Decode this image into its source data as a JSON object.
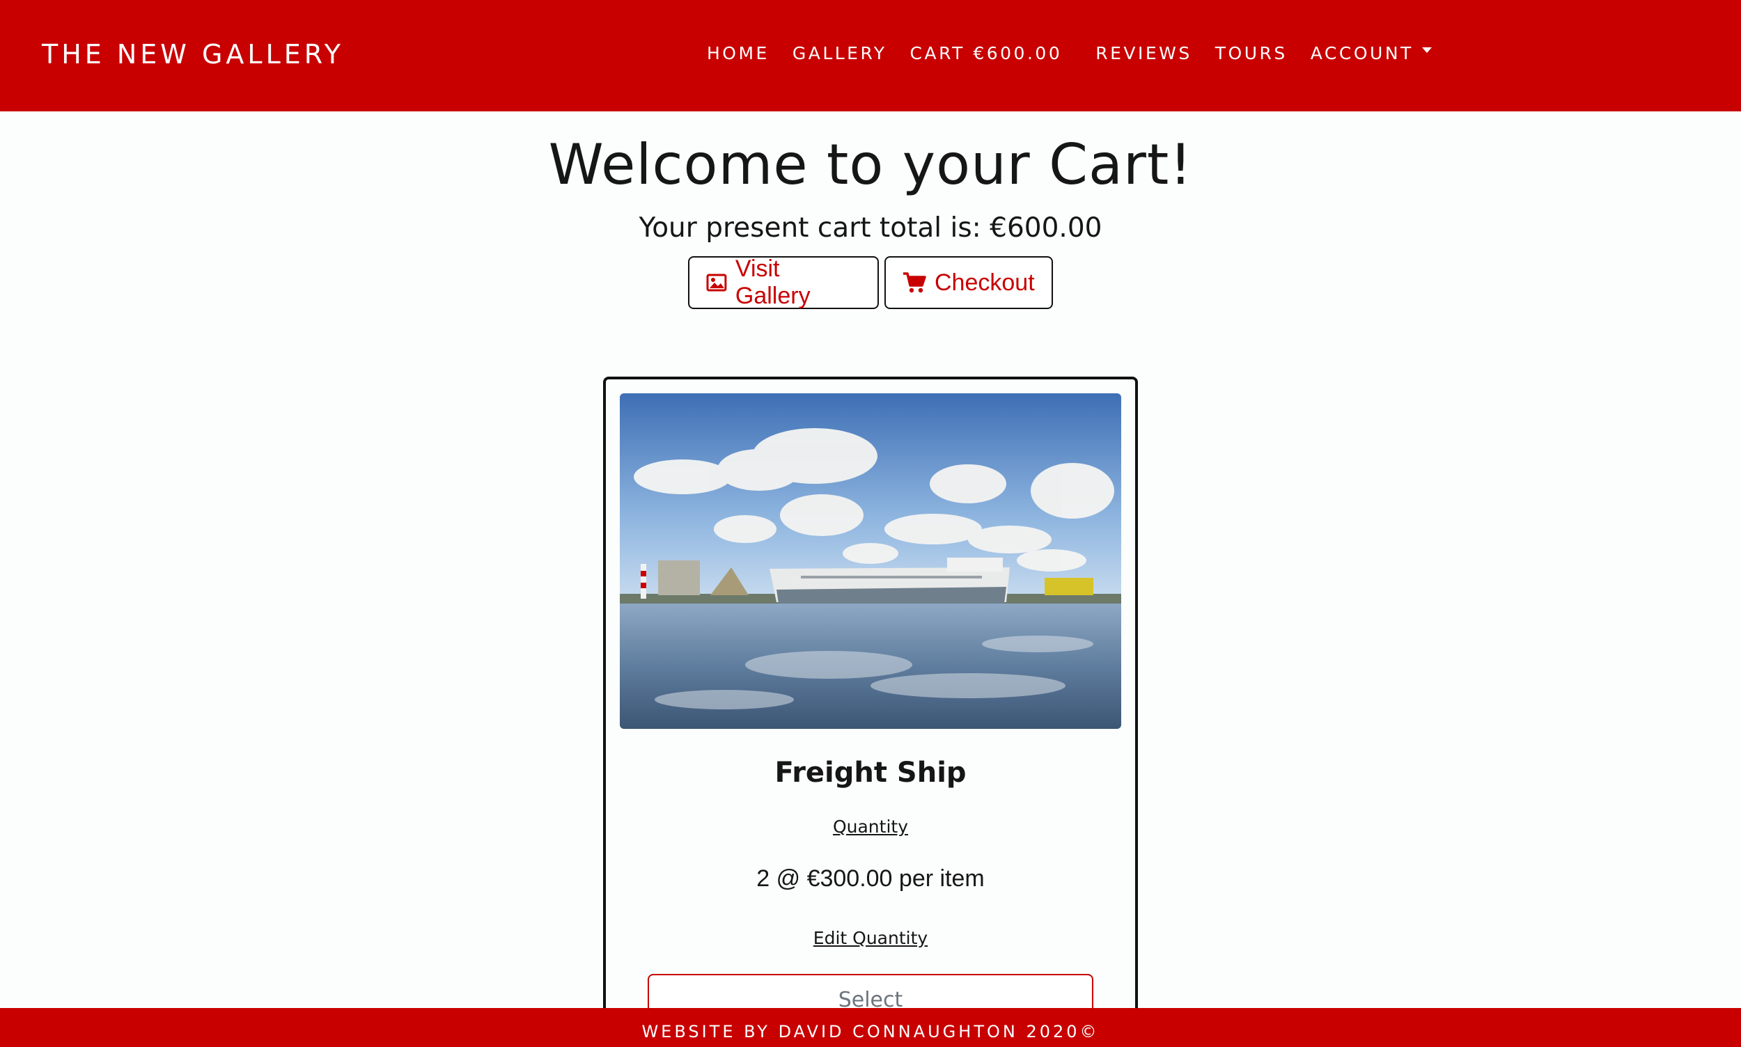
{
  "brand": "THE NEW GALLERY",
  "nav": {
    "home": "HOME",
    "gallery": "GALLERY",
    "cart": "CART €600.00",
    "reviews": "REVIEWS",
    "tours": "TOURS",
    "account": "ACCOUNT"
  },
  "hero": {
    "title": "Welcome to your Cart!",
    "subtitle": "Your present cart total is: €600.00"
  },
  "buttons": {
    "visit_gallery": "Visit Gallery",
    "checkout": "Checkout"
  },
  "cart_item": {
    "title": "Freight Ship",
    "quantity_label": "Quantity",
    "quantity_price": "2 @ €300.00 per item",
    "edit_quantity": "Edit Quantity",
    "select_placeholder": "Select"
  },
  "footer": "WEBSITE BY DAVID CONNAUGHTON 2020©",
  "colors": {
    "brand_red": "#c80000",
    "background": "#fbfefc",
    "text": "#161616"
  },
  "icons": {
    "visit_gallery": "image-icon",
    "checkout": "shopping-cart-icon",
    "account": "caret-down-icon"
  }
}
